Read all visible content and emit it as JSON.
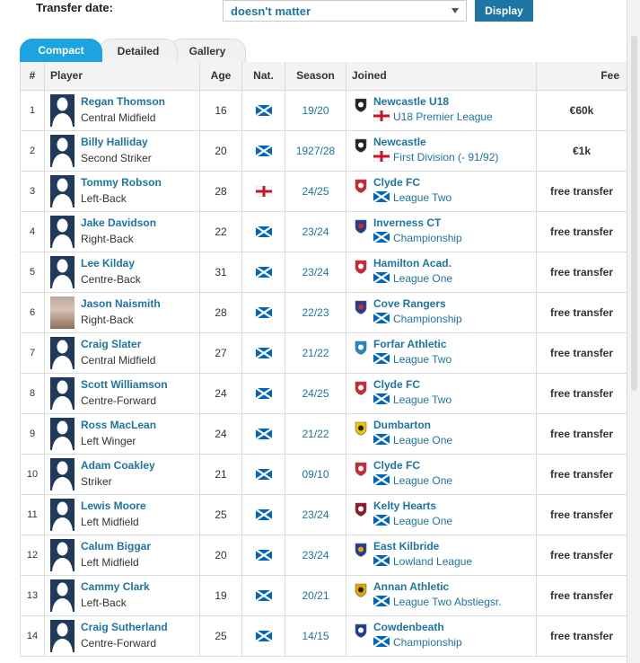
{
  "filter": {
    "label": "Transfer date:",
    "selected": "doesn't matter",
    "button": "Display"
  },
  "tabs": [
    "Compact",
    "Detailed",
    "Gallery"
  ],
  "columns": [
    "#",
    "Player",
    "Age",
    "Nat.",
    "Season",
    "Joined",
    "Fee"
  ],
  "rows": [
    {
      "num": "1",
      "name": "Regan Thomson",
      "position": "Central Midfield",
      "age": "16",
      "nat": "scotland",
      "season": "19/20",
      "club": "Newcastle U18",
      "league_flag": "england",
      "league": "U18 Premier League",
      "fee": "€60k"
    },
    {
      "num": "2",
      "name": "Billy Halliday",
      "position": "Second Striker",
      "age": "20",
      "nat": "scotland",
      "season": "1927/28",
      "club": "Newcastle",
      "league_flag": "england",
      "league": "First Division (- 91/92)",
      "fee": "€1k"
    },
    {
      "num": "3",
      "name": "Tommy Robson",
      "position": "Left-Back",
      "age": "28",
      "nat": "england",
      "season": "24/25",
      "club": "Clyde FC",
      "league_flag": "scotland",
      "league": "League Two",
      "fee": "free transfer"
    },
    {
      "num": "4",
      "name": "Jake Davidson",
      "position": "Right-Back",
      "age": "22",
      "nat": "scotland",
      "season": "23/24",
      "club": "Inverness CT",
      "league_flag": "scotland",
      "league": "Championship",
      "fee": "free transfer"
    },
    {
      "num": "5",
      "name": "Lee Kilday",
      "position": "Centre-Back",
      "age": "31",
      "nat": "scotland",
      "season": "23/24",
      "club": "Hamilton Acad.",
      "league_flag": "scotland",
      "league": "League One",
      "fee": "free transfer"
    },
    {
      "num": "6",
      "name": "Jason Naismith",
      "position": "Right-Back",
      "age": "28",
      "nat": "scotland",
      "season": "22/23",
      "club": "Cove Rangers",
      "league_flag": "scotland",
      "league": "Championship",
      "fee": "free transfer"
    },
    {
      "num": "7",
      "name": "Craig Slater",
      "position": "Central Midfield",
      "age": "27",
      "nat": "scotland",
      "season": "21/22",
      "club": "Forfar Athletic",
      "league_flag": "scotland",
      "league": "League Two",
      "fee": "free transfer"
    },
    {
      "num": "8",
      "name": "Scott Williamson",
      "position": "Centre-Forward",
      "age": "24",
      "nat": "scotland",
      "season": "24/25",
      "club": "Clyde FC",
      "league_flag": "scotland",
      "league": "League Two",
      "fee": "free transfer"
    },
    {
      "num": "9",
      "name": "Ross MacLean",
      "position": "Left Winger",
      "age": "24",
      "nat": "scotland",
      "season": "21/22",
      "club": "Dumbarton",
      "league_flag": "scotland",
      "league": "League One",
      "fee": "free transfer"
    },
    {
      "num": "10",
      "name": "Adam Coakley",
      "position": "Striker",
      "age": "21",
      "nat": "scotland",
      "season": "09/10",
      "club": "Clyde FC",
      "league_flag": "scotland",
      "league": "League One",
      "fee": "free transfer"
    },
    {
      "num": "11",
      "name": "Lewis Moore",
      "position": "Left Midfield",
      "age": "25",
      "nat": "scotland",
      "season": "23/24",
      "club": "Kelty Hearts",
      "league_flag": "scotland",
      "league": "League One",
      "fee": "free transfer"
    },
    {
      "num": "12",
      "name": "Calum Biggar",
      "position": "Left Midfield",
      "age": "20",
      "nat": "scotland",
      "season": "23/24",
      "club": "East Kilbride",
      "league_flag": "scotland",
      "league": "Lowland League",
      "fee": "free transfer"
    },
    {
      "num": "13",
      "name": "Cammy Clark",
      "position": "Left-Back",
      "age": "19",
      "nat": "scotland",
      "season": "20/21",
      "club": "Annan Athletic",
      "league_flag": "scotland",
      "league": "League Two Abstiegsr.",
      "fee": "free transfer"
    },
    {
      "num": "14",
      "name": "Craig Sutherland",
      "position": "Centre-Forward",
      "age": "25",
      "nat": "scotland",
      "season": "14/15",
      "club": "Cowdenbeath",
      "league_flag": "scotland",
      "league": "Championship",
      "fee": "free transfer"
    }
  ],
  "colors": {
    "link": "#1d75a3",
    "tab_active": "#1ea3e1",
    "button": "#1d75a3",
    "avatar": "#1f3a5a"
  }
}
